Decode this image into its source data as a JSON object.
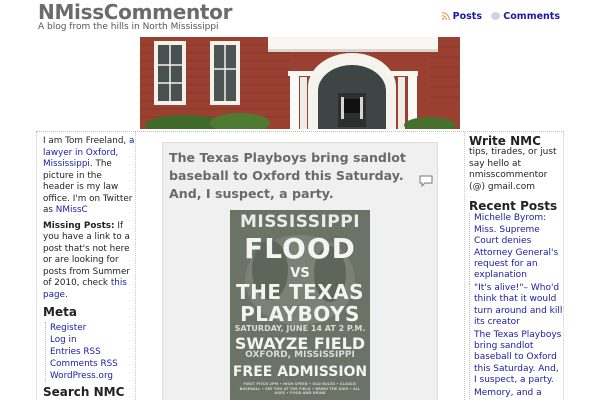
{
  "header": {
    "site_title": "NMissCommentor",
    "tagline": "A blog from the hills in North Mississippi",
    "feed_posts": "Posts",
    "feed_comments": "Comments"
  },
  "left_sidebar": {
    "about": {
      "t1": "I am Tom Freeland, ",
      "link_lawyer": "a lawyer in Oxford, Mississippi",
      "t2": ". The picture in the header is my law office. I'm on Twitter as ",
      "link_twitter": "NMissC"
    },
    "missing": {
      "label": "Missing Posts:",
      "t1": " If you have a link to a post that's not here or are looking for posts from Summer of 2010, check ",
      "link": "this page",
      "t2": "."
    },
    "meta_title": "Meta",
    "meta_items": [
      "Register",
      "Log in",
      "Entries RSS",
      "Comments RSS",
      "WordPress.org"
    ],
    "search_title": "Search NMC"
  },
  "post": {
    "title": "The Texas Playboys bring sandlot baseball to Oxford this Saturday. And, I suspect, a party."
  },
  "poster": {
    "line1": "MISSISSIPPI",
    "line2": "FLOOD",
    "line3": "VS",
    "line4": "THE TEXAS",
    "line5": "PLAYBOYS",
    "line6": "SATURDAY, JUNE 14 AT 2 P.M.",
    "line7": "SWAYZE FIELD",
    "line8": "OXFORD, MISSISSIPPI",
    "line9": "FREE ADMISSION",
    "fine_print": "FIRST PITCH 2PM • HIGH SPEED • OLD RULES • CLASSIC BASEBALL • SEE YOU AT THE FIELD • BRING THE KIDS • ALL AGES • FOOD AND DRINK"
  },
  "right_sidebar": {
    "write_title": "Write NMC",
    "write_text": "tips, tirades, or just say hello at nmisscommentor (@) gmail.com",
    "recent_title": "Recent Posts",
    "recent_posts": [
      "Michelle Byrom: Miss. Supreme Court denies Attorney General's request for an explanation",
      "\"It's alive!\"– Who'd think that it would turn around and kill its creator",
      "The Texas Playboys bring sandlot baseball to Oxford this Saturday. And, I suspect, a party.",
      "Memory, and a"
    ]
  },
  "colors": {
    "link": "#1a1aa6",
    "title_gray": "#6b6b6b",
    "post_bg": "#f0f0f0",
    "brick": "#9a4030"
  },
  "icons": {
    "feed": "rss-icon",
    "comments": "speech-bubble-icon",
    "post_comments": "comment-icon"
  }
}
